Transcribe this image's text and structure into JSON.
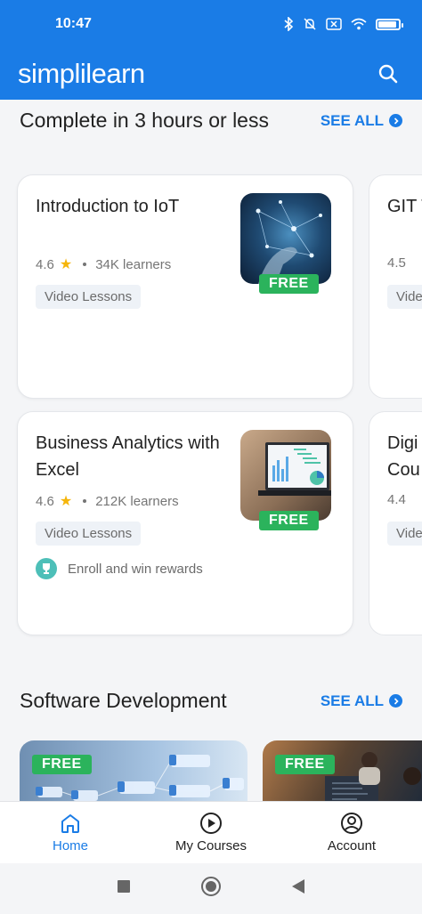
{
  "status_bar": {
    "time": "10:47"
  },
  "header": {
    "logo": "simplilearn",
    "search_icon": "search-icon"
  },
  "sections": [
    {
      "title": "Complete in 3 hours or less",
      "see_all": "SEE ALL",
      "courses": [
        {
          "title": "Introduction to IoT",
          "rating": "4.6",
          "learners": "34K learners",
          "tag": "Video Lessons",
          "badge": "FREE"
        },
        {
          "title": "Business Analytics with Excel",
          "rating": "4.6",
          "learners": "212K learners",
          "tag": "Video Lessons",
          "badge": "FREE",
          "reward": "Enroll and win rewards"
        }
      ],
      "peek_courses": [
        {
          "title": "GIT T",
          "rating": "4.5",
          "tag": "Vide"
        },
        {
          "title": "Digi",
          "title2": "Cou",
          "rating": "4.4",
          "tag": "Vide"
        }
      ]
    },
    {
      "title": "Software Development",
      "see_all": "SEE ALL",
      "banners": [
        {
          "badge": "FREE"
        },
        {
          "badge": "FREE"
        }
      ]
    }
  ],
  "bottom_nav": [
    {
      "label": "Home",
      "icon": "home-icon",
      "active": true
    },
    {
      "label": "My Courses",
      "icon": "play-circle-icon",
      "active": false
    },
    {
      "label": "Account",
      "icon": "account-icon",
      "active": false
    }
  ],
  "colors": {
    "brand": "#1a7ce6",
    "free_badge": "#2bb35c",
    "star": "#f5b50a"
  }
}
